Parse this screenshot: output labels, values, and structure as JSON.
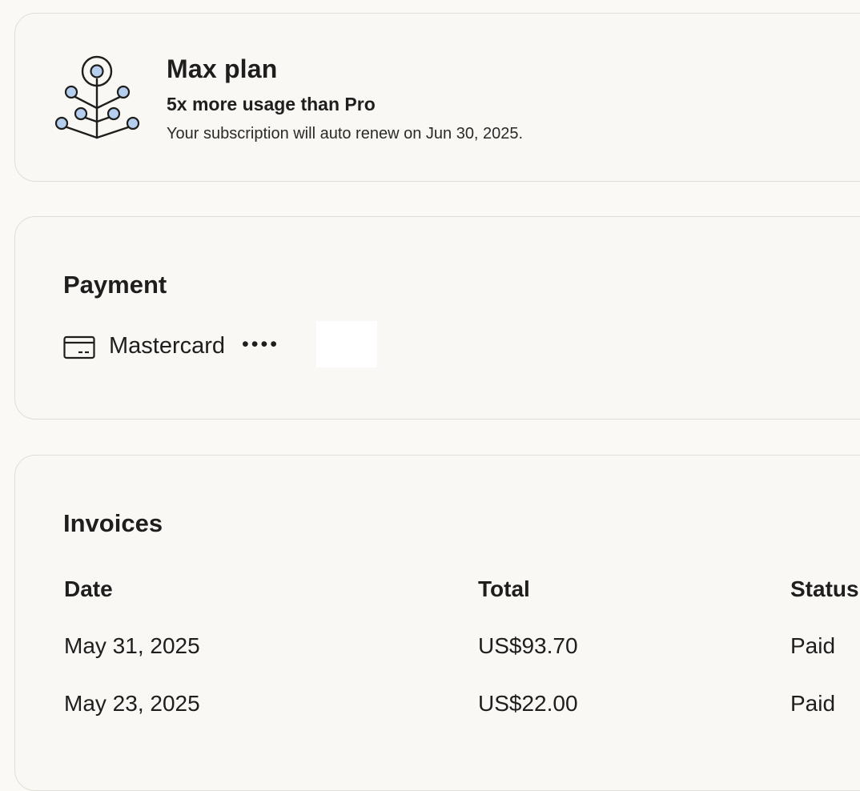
{
  "plan": {
    "icon": "plan-tree-icon",
    "name": "Max plan",
    "tagline": "5x more usage than Pro",
    "renewal_text": "Your subscription will auto renew on Jun 30, 2025."
  },
  "payment": {
    "title": "Payment",
    "card_icon": "credit-card-icon",
    "card_brand": "Mastercard",
    "card_mask": "••••"
  },
  "invoices": {
    "title": "Invoices",
    "columns": [
      "Date",
      "Total",
      "Status"
    ],
    "rows": [
      {
        "date": "May 31, 2025",
        "total": "US$93.70",
        "status": "Paid"
      },
      {
        "date": "May 23, 2025",
        "total": "US$22.00",
        "status": "Paid"
      }
    ]
  },
  "colors": {
    "background": "#faf9f5",
    "icon_fill": "#b6cfef",
    "text": "#1f1e1d",
    "border": "#e1ded6"
  }
}
